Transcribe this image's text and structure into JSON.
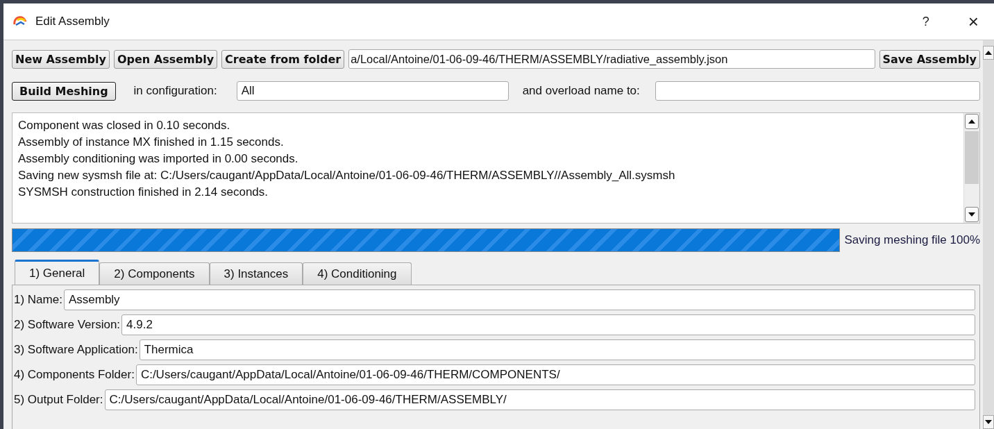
{
  "window": {
    "title": "Edit Assembly",
    "help": "?",
    "close": "×"
  },
  "toolbar": {
    "buttons": [
      "New Assembly",
      "Open Assembly",
      "Create from folder"
    ],
    "path_value": "a/Local/Antoine/01-06-09-46/THERM/ASSEMBLY/radiative_assembly.json",
    "save_button": "Save Assembly"
  },
  "build": {
    "button": "Build Meshing",
    "configuration_label": "in configuration:",
    "configuration_value": "All",
    "overload_label": "and overload name to:"
  },
  "log": [
    "Component was closed in 0.10 seconds.",
    "Assembly of instance MX finished in 1.15 seconds.",
    "Assembly conditioning was imported in 0.00 seconds.",
    "Saving new sysmsh file at: C:/Users/caugant/AppData/Local/Antoine/01-06-09-46/THERM/ASSEMBLY//Assembly_All.sysmsh",
    "SYSMSH construction finished in 2.14 seconds."
  ],
  "progress": {
    "level": 1,
    "label": "Saving meshing file 100%"
  },
  "tabs": [
    {
      "label": "1) General",
      "selected": true
    },
    {
      "label": "2) Components",
      "selected": false
    },
    {
      "label": "3) Instances",
      "selected": false
    },
    {
      "label": "4) Conditioning",
      "selected": false
    }
  ],
  "fields": [
    {
      "label": "1) Name:",
      "value": "Assembly"
    },
    {
      "label": "2) Software Version:",
      "value": "4.9.2"
    },
    {
      "label": "3) Software Application:",
      "value": "Thermica"
    },
    {
      "label": "4) Components Folder:",
      "value": "C:/Users/caugant/AppData/Local/Antoine/01-06-09-46/THERM/COMPONENTS/"
    },
    {
      "label": "5) Output Folder:",
      "value": "C:/Users/caugant/AppData/Local/Antoine/01-06-09-46/THERM/ASSEMBLY/"
    }
  ]
}
